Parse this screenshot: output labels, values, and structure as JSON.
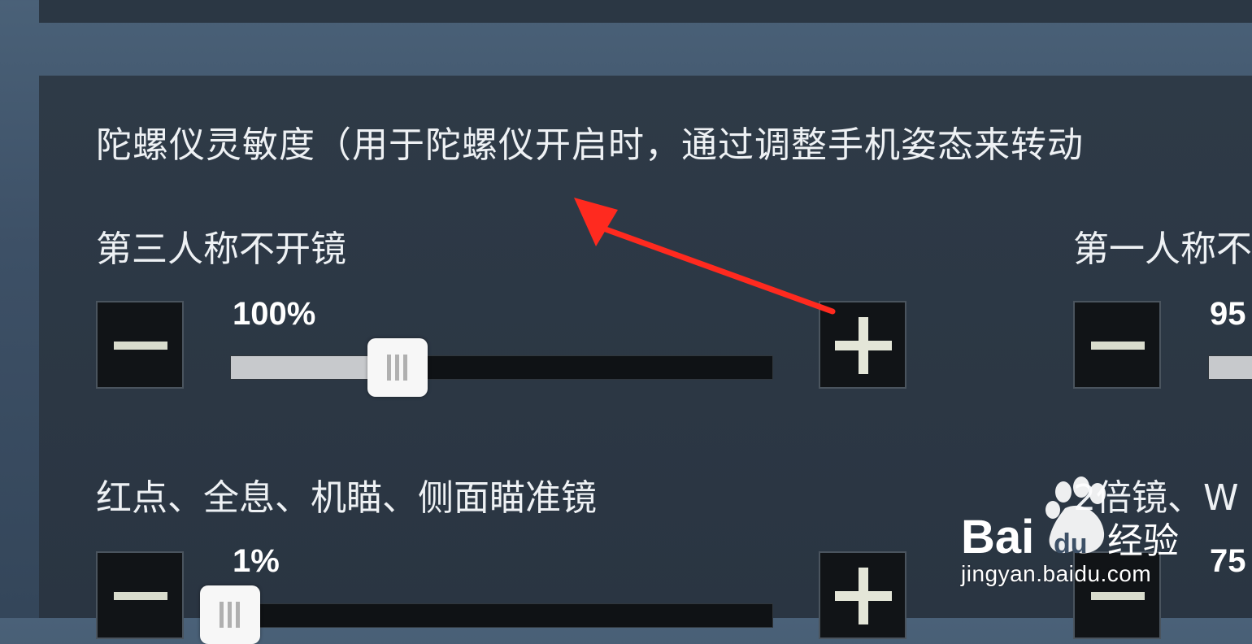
{
  "panel": {
    "title": "陀螺仪灵敏度（用于陀螺仪开启时，通过调整手机姿态来转动"
  },
  "sections": [
    {
      "label": "第三人称不开镜",
      "value_text": "100%",
      "level": 0.31
    },
    {
      "label": "第一人称不",
      "value_text": "95"
    },
    {
      "label": "红点、全息、机瞄、侧面瞄准镜",
      "value_text": "1%",
      "level": 0.0
    },
    {
      "label": "2倍镜、W",
      "value_text": "75"
    }
  ],
  "icons": {
    "minus": "minus-icon",
    "plus": "plus-icon"
  },
  "annotation": {
    "arrow_color": "#ff2a1f"
  },
  "watermark": {
    "brand": "Bai",
    "brand2": "du",
    "suffix": "经验",
    "url": "jingyan.baidu.com"
  }
}
